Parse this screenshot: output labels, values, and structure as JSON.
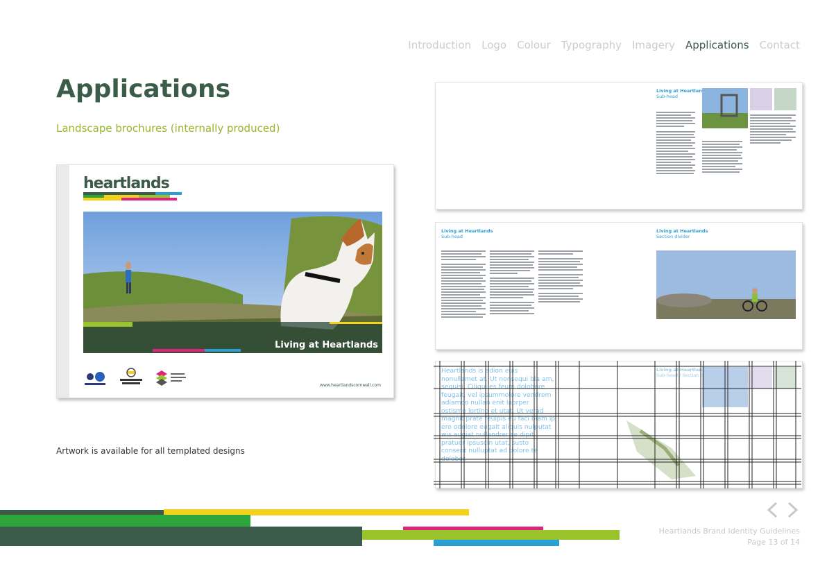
{
  "nav": {
    "items": [
      "Introduction",
      "Logo",
      "Colour",
      "Typography",
      "Imagery",
      "Applications",
      "Contact"
    ],
    "active": "Applications"
  },
  "page": {
    "title": "Applications",
    "subtitle": "Landscape brochures (internally produced)",
    "caption": "Artwork is available for all templated designs"
  },
  "brochure": {
    "logo_text": "heartlands",
    "photo_label": "Living at Heartlands",
    "url": "www.heartlandscornwall.com"
  },
  "spreads": {
    "intro_text": "Heartlands is adion euis nonullamet at. Ut nonsequi bla am, sequisi. Ciliqui es feum dolobore feugait, vel ipsummolore vendrem adiamco nullan enit laorper ostismo lorting et utat. Ut verad magnit prate feuipis eu faci blam ip ero odolore eugait aliquis nulputat wis augiat nullandrer se dipit pratuer ipsuscin utat, susto consent nulluptat ad dolore te dolobor.",
    "s1_head": "Living at Heartlands",
    "s1_sub": "Sub-head",
    "s2_head": "Living at Heartlands",
    "s2_sub": "Sub-head",
    "s3_head": "Living at Heartlands",
    "s3_sub": "Section divider",
    "s4_head": "Living at Heartlands",
    "s4_sub": "Sub-head / Section divider"
  },
  "footer": {
    "doc_title": "Heartlands Brand Identity Guidelines",
    "page_label": "Page 13 of 14"
  },
  "colors": {
    "green_dark": "#3c5c4a",
    "green_bright": "#2ca53a",
    "lime": "#98c32a",
    "yellow": "#f5d11c",
    "magenta": "#e0237e",
    "blue": "#2a9fd6"
  },
  "icons": {
    "prev": "chevron-left-icon",
    "next": "chevron-right-icon"
  }
}
